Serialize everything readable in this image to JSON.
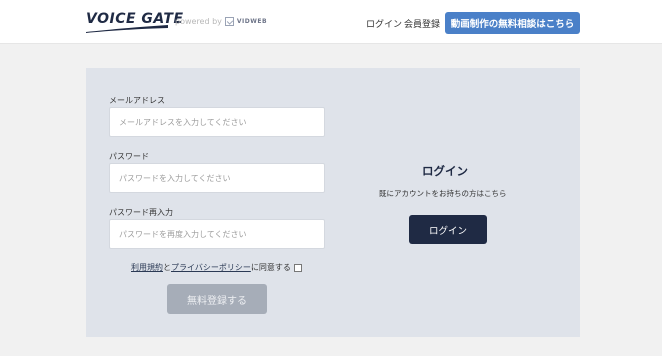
{
  "header": {
    "logo_text": "VOICE GATE",
    "powered_by": "powered by",
    "powered_brand": "VIDWEB",
    "login_link": "ログイン",
    "register_link": "会員登録",
    "cta_label": "動画制作の無料相談はこちら"
  },
  "form": {
    "email": {
      "label": "メールアドレス",
      "value": "",
      "placeholder": "メールアドレスを入力してください"
    },
    "password": {
      "label": "パスワード",
      "value": "",
      "placeholder": "パスワードを入力してください"
    },
    "password_confirm": {
      "label": "パスワード再入力",
      "value": "",
      "placeholder": "パスワードを再度入力してください"
    },
    "agreement": {
      "terms_link": "利用規約",
      "and_text": "と",
      "privacy_link": "プライバシーポリシー",
      "suffix": "に同意する",
      "checked": false
    },
    "submit_label": "無料登録する"
  },
  "login": {
    "heading": "ログイン",
    "caption": "既にアカウントをお持ちの方はこちら",
    "button_label": "ログイン"
  },
  "colors": {
    "page_bg": "#f1f1f1",
    "panel_bg": "#dfe3ea",
    "accent_blue": "#4a80c8",
    "navy": "#1f2a44",
    "disabled_gray": "#a6adb8"
  }
}
